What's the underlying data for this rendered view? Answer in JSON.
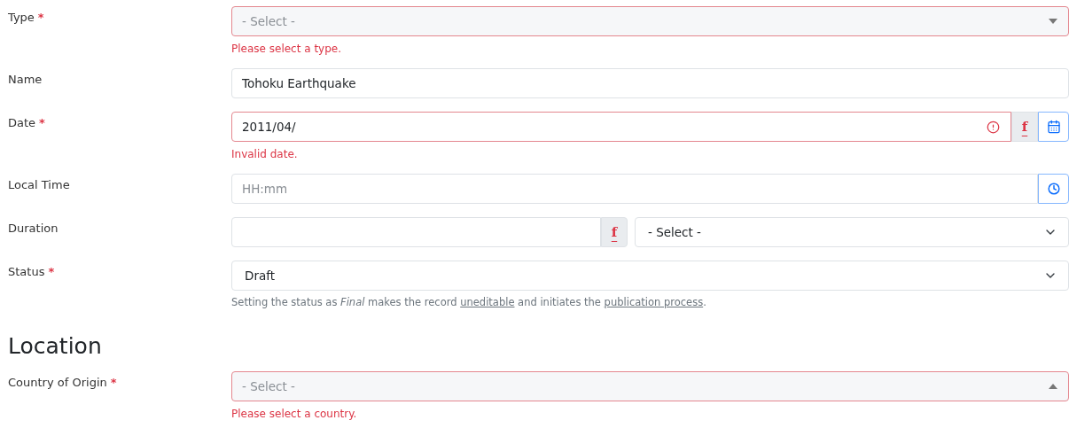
{
  "fields": [
    {
      "kind": "combo",
      "label": "Type",
      "required_mark": "*",
      "placeholder": "- Select -",
      "expanded": false,
      "invalid": true,
      "error": "Please select a type."
    },
    {
      "kind": "text",
      "label": "Name",
      "value": "Tohoku Earthquake",
      "invalid": false
    },
    {
      "kind": "date",
      "label": "Date",
      "required_mark": "*",
      "value": "2011/04/",
      "invalid": true,
      "error": "Invalid date.",
      "formula_button": "f"
    },
    {
      "kind": "time",
      "label": "Local Time",
      "placeholder": "HH:mm",
      "invalid": false
    },
    {
      "kind": "duration",
      "label": "Duration",
      "formula_button": "f",
      "unit": "- Select -",
      "invalid": false
    },
    {
      "kind": "select",
      "label": "Status",
      "required_mark": "*",
      "value": "Draft",
      "invalid": false,
      "help": [
        {
          "kind": "text",
          "text": "Setting the status as *Final* makes the record "
        },
        {
          "kind": "link",
          "text": "uneditable"
        },
        {
          "kind": "text",
          "text": " and initiates the "
        },
        {
          "kind": "link",
          "text": "publication process"
        },
        {
          "kind": "text",
          "text": "."
        }
      ]
    }
  ],
  "section": {
    "title": "Location"
  },
  "location_fields": [
    {
      "kind": "combo",
      "label": "Country of Origin",
      "required_mark": "*",
      "placeholder": "- Select -",
      "expanded": true,
      "invalid": true,
      "error": "Please select a country."
    }
  ]
}
